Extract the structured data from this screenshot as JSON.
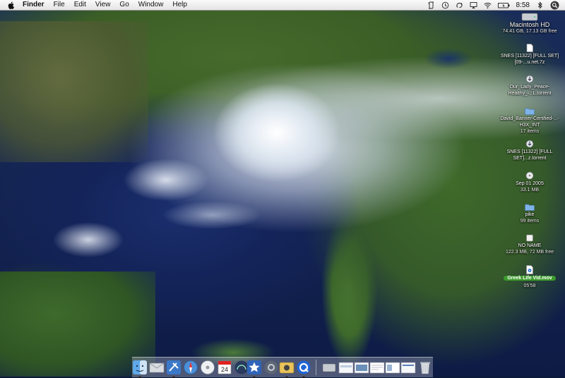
{
  "menubar": {
    "apple": "apple-menu",
    "app_name": "Finder",
    "menus": [
      "File",
      "Edit",
      "View",
      "Go",
      "Window",
      "Help"
    ],
    "status_icons": [
      "script-icon",
      "time-machine-icon",
      "sync-icon",
      "airplay-icon",
      "wifi-icon",
      "battery-icon",
      "bluetooth-icon"
    ],
    "clock": "8:58",
    "spotlight": "spotlight-icon"
  },
  "desktop": {
    "items": [
      {
        "name": "Macintosh HD",
        "sub": "74.41 GB, 17.13 GB free",
        "icon": "hard-drive-icon"
      },
      {
        "name": "SNES [11322] [FULL SET] [09-...u.net.7z",
        "sub": "",
        "icon": "document-icon"
      },
      {
        "name": "Our_Lady_Peace-Healthy_i...L.torrent",
        "sub": "",
        "icon": "torrent-icon"
      },
      {
        "name": "David_Banner-Certified-...-H3X_INT",
        "sub": "17 items",
        "icon": "folder-icon"
      },
      {
        "name": "SNES [11322] [FULL SET]...z.torrent",
        "sub": "",
        "icon": "torrent-icon"
      },
      {
        "name": "Sep 01 2005",
        "sub": "33.1 MB",
        "icon": "disc-image-icon"
      },
      {
        "name": "pike",
        "sub": "99 items",
        "icon": "folder-icon"
      },
      {
        "name": "NO NAME",
        "sub": "122.3 MB, 72 MB free",
        "icon": "usb-drive-icon"
      },
      {
        "name": "Greek Life Vid.mov",
        "sub": "05'58",
        "icon": "movie-file-icon",
        "selected": true
      }
    ]
  },
  "dock": {
    "apps": [
      "finder-icon",
      "mail-icon",
      "xcode-icon",
      "safari-icon",
      "itunes-icon",
      "ical-icon",
      "dashboard-icon",
      "system-preferences-icon",
      "image-capture-icon",
      "quicktime-icon"
    ],
    "right": [
      "hard-drive-window-icon",
      "minimized-window-icon",
      "minimized-window-icon",
      "minimized-window-icon",
      "minimized-window-icon",
      "minimized-window-icon",
      "trash-icon"
    ],
    "colors": {
      "accent": "#3b9a2b",
      "menubar": "#ececec"
    }
  }
}
